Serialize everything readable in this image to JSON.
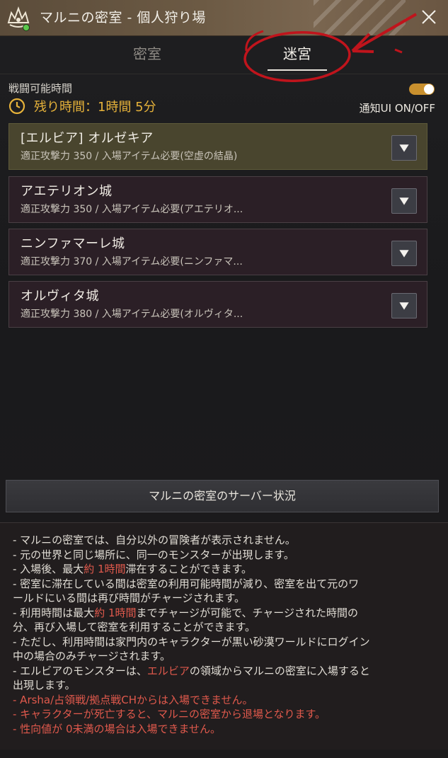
{
  "window": {
    "title": "マルニの密室 - 個人狩り場"
  },
  "tabs": [
    {
      "label": "密室",
      "active": false
    },
    {
      "label": "迷宮",
      "active": true
    }
  ],
  "battle": {
    "label": "戦闘可能時間",
    "remaining": "残り時間：1時間 5分",
    "notify_label": "通知UI ON/OFF",
    "notify_on": true
  },
  "dungeons": [
    {
      "name": "[エルビア] オルゼキア",
      "desc": "適正攻撃力 350 / 入場アイテム必要(空虚の結晶)",
      "active": true
    },
    {
      "name": "アエテリオン城",
      "desc": "適正攻撃力 350 / 入場アイテム必要(アエテリオ...",
      "active": false
    },
    {
      "name": "ニンファマーレ城",
      "desc": "適正攻撃力 370 / 入場アイテム必要(ニンファマ...",
      "active": false
    },
    {
      "name": "オルヴィタ城",
      "desc": "適正攻撃力 380 / 入場アイテム必要(オルヴィタ...",
      "active": false
    }
  ],
  "server_status_label": "マルニの密室のサーバー状況",
  "notes": {
    "n1": "- マルニの密室では、自分以外の冒険者が表示されません。",
    "n2": "- 元の世界と同じ場所に、同一のモンスターが出現します。",
    "n3a": "- 入場後、最大",
    "n3b": "約 1時間",
    "n3c": "滞在することができます。",
    "n4a": "- 密室に滞在している間は密室の利用可能時間が減り、密室を出て元のワ",
    "n4b": "ールドにいる間は再び時間がチャージされます。",
    "n5a": "- 利用時間は最大",
    "n5b": "約 1時間",
    "n5c": "までチャージが可能で、チャージされた時間の",
    "n5d": "分、再び入場して密室を利用することができます。",
    "n6a": "- ただし、利用時間は家門内のキャラクターが黒い砂漠ワールドにログイン",
    "n6b": "中の場合のみチャージされます。",
    "n7a": "- エルビアのモンスターは、",
    "n7b": "エルビア",
    "n7c": "の領域からマルニの密室に入場すると",
    "n7d": "出現します。",
    "n8": "- Arsha/占領戦/拠点戦CHからは入場できません。",
    "n9": "- キャラクターが死亡すると、マルニの密室から退場となります。",
    "n10": "- 性向値が 0未満の場合は入場できません。"
  },
  "colors": {
    "accent_gold": "#e6b23a",
    "warning_red": "#e0594c",
    "annotation_red": "#c0141c"
  }
}
